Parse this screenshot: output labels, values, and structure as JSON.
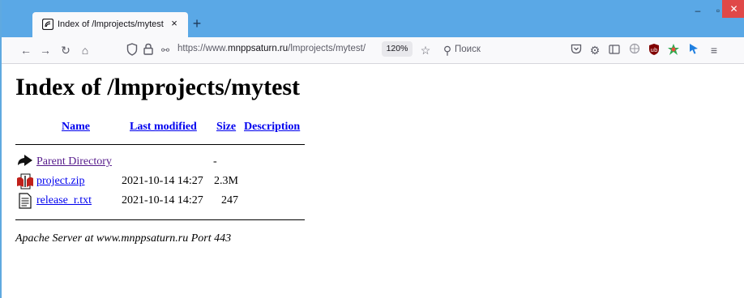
{
  "browser": {
    "tab_title": "Index of /lmprojects/mytest",
    "tab_close": "×",
    "new_tab": "+",
    "url_prefix": "https://www.",
    "url_domain": "mnppsaturn.ru",
    "url_path": "/lmprojects/mytest/",
    "zoom": "120%",
    "search_placeholder": "Поиск",
    "window_min": "–",
    "window_max": "▫",
    "window_close": "✕"
  },
  "page": {
    "heading": "Index of /lmprojects/mytest",
    "columns": {
      "name": "Name",
      "last_modified": "Last modified",
      "size": "Size",
      "description": "Description"
    },
    "rows": [
      {
        "name": "Parent Directory",
        "modified": "",
        "size": "-",
        "icon": "parent-directory-icon"
      },
      {
        "name": "project.zip",
        "modified": "2021-10-14 14:27",
        "size": "2.3M",
        "icon": "zip-file-icon"
      },
      {
        "name": "release_r.txt",
        "modified": "2021-10-14 14:27",
        "size": "247",
        "icon": "text-file-icon"
      }
    ],
    "footer": "Apache Server at www.mnppsaturn.ru Port 443"
  },
  "colors": {
    "tabstrip": "#5aa8e6",
    "link": "#0000ee",
    "visited_link": "#551a8b",
    "close_button": "#e04848"
  }
}
